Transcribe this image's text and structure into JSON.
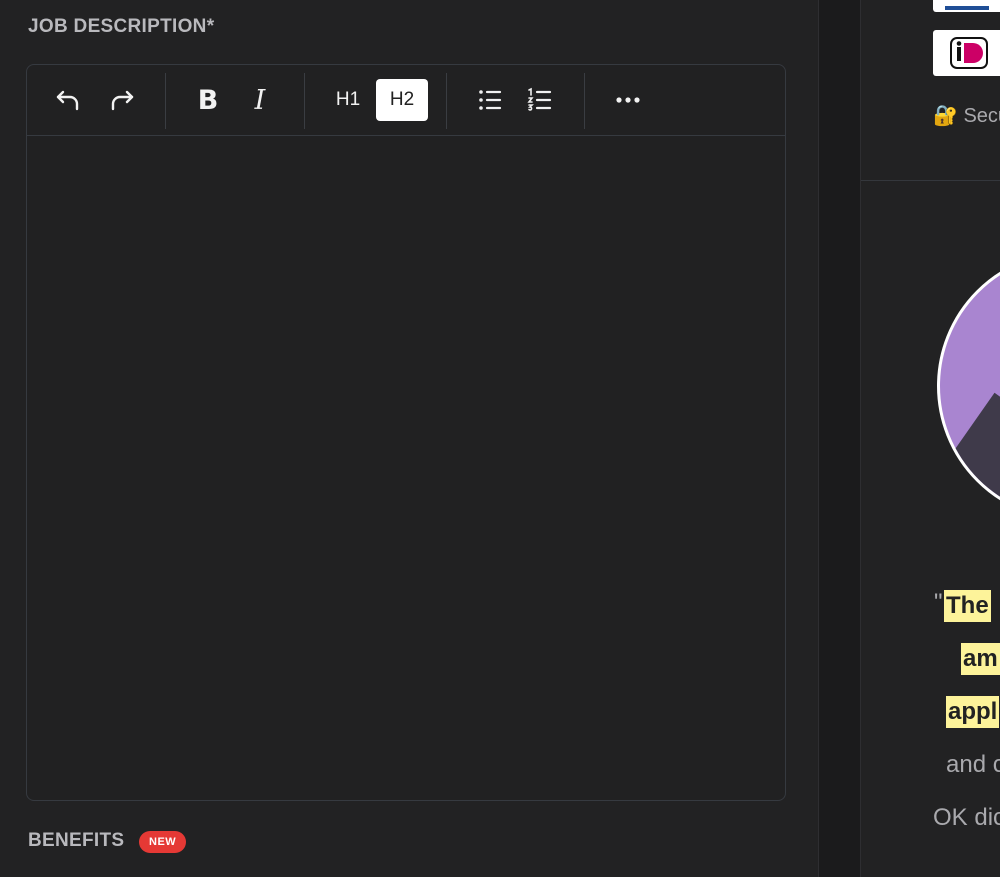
{
  "job_description": {
    "label": "JOB DESCRIPTION*",
    "toolbar": {
      "h1": "H1",
      "h2": "H2",
      "bold": "B",
      "italic": "I",
      "active": "h2"
    },
    "content": ""
  },
  "benefits": {
    "label": "BENEFITS",
    "badge": "NEW"
  },
  "sidebar": {
    "secure_text": "Secu",
    "quote": {
      "open": "\"",
      "line1": "The",
      "line2": "am",
      "line3": "appl",
      "line4": "and c",
      "line5": "OK dic"
    }
  },
  "colors": {
    "badge": "#e53935",
    "highlight": "#fdf39a",
    "avatar_bg": "#a985d0",
    "ideal_pink": "#cc0066"
  }
}
